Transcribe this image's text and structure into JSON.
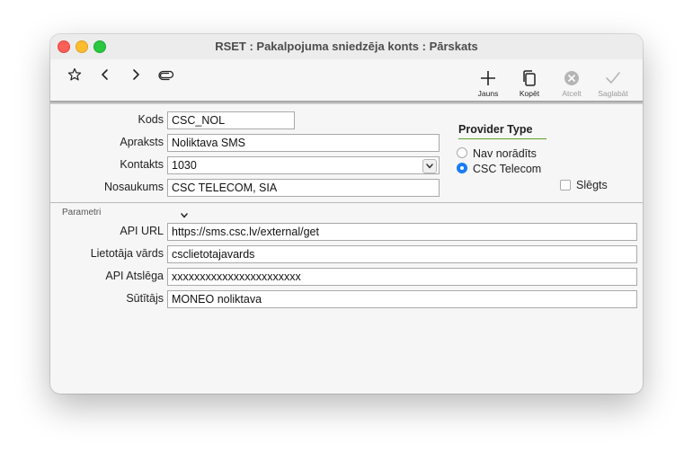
{
  "window": {
    "title": "RSET : Pakalpojuma sniedzēja konts : Pārskats"
  },
  "toolbar": {
    "new_label": "Jauns",
    "copy_label": "Kopēt",
    "cancel_label": "Atcelt",
    "save_label": "Saglabāt"
  },
  "form": {
    "kods": {
      "label": "Kods",
      "value": "CSC_NOL"
    },
    "apraksts": {
      "label": "Apraksts",
      "value": "Noliktava SMS"
    },
    "kontakts": {
      "label": "Kontakts",
      "value": "1030"
    },
    "nosaukums": {
      "label": "Nosaukums",
      "value": "CSC TELECOM, SIA"
    }
  },
  "provider_type": {
    "title": "Provider Type",
    "options": [
      {
        "label": "Nav norādīts",
        "selected": false
      },
      {
        "label": "CSC Telecom",
        "selected": true
      }
    ]
  },
  "slegts": {
    "label": "Slēgts",
    "checked": false
  },
  "parametri": {
    "title": "Parametri",
    "api_url": {
      "label": "API URL",
      "value": "https://sms.csc.lv/external/get"
    },
    "lietotaja_vards": {
      "label": "Lietotāja vārds",
      "value": "csclietotajavards"
    },
    "api_atslega": {
      "label": "API Atslēga",
      "value": "xxxxxxxxxxxxxxxxxxxxxxx"
    },
    "sutitajs": {
      "label": "Sūtītājs",
      "value": "MONEO noliktava"
    }
  },
  "colors": {
    "accent": "#1a7cf4",
    "group_underline": "#5aa02c",
    "close": "#fe5f57",
    "minimize": "#febc2e",
    "maximize": "#28c840"
  },
  "icons": [
    "star-icon",
    "back-icon",
    "forward-icon",
    "paperclip-icon",
    "plus-icon",
    "copy-icon",
    "cancel-icon",
    "checkmark-icon",
    "chevron-down-icon"
  ]
}
